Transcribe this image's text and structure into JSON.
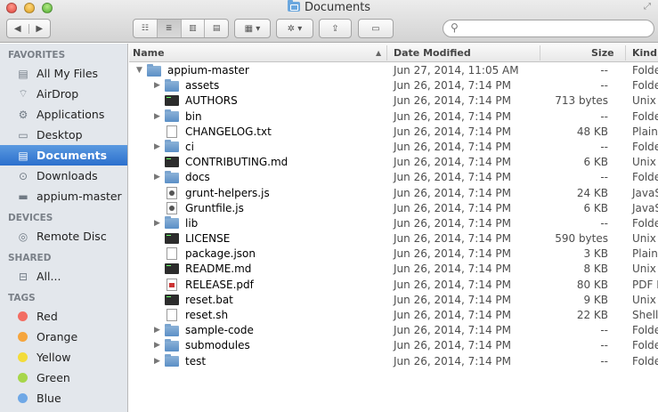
{
  "window": {
    "title": "Documents",
    "nav_back": "◀",
    "nav_forward": "▶",
    "view_icons": [
      "☷",
      "≣",
      "▥",
      "▤"
    ],
    "arrange": "▦ ▾",
    "action": "✲ ▾",
    "share": "⇪",
    "tag": "▭",
    "search": {
      "value": "",
      "placeholder": ""
    }
  },
  "sidebar": {
    "favorites_label": "FAVORITES",
    "favorites": [
      {
        "label": "All My Files",
        "icon": "all-files-icon",
        "glyph": "▤"
      },
      {
        "label": "AirDrop",
        "icon": "airdrop-icon",
        "glyph": "⌔"
      },
      {
        "label": "Applications",
        "icon": "applications-icon",
        "glyph": "⚙"
      },
      {
        "label": "Desktop",
        "icon": "desktop-icon",
        "glyph": "▭"
      },
      {
        "label": "Documents",
        "icon": "documents-icon",
        "glyph": "▤",
        "selected": true
      },
      {
        "label": "Downloads",
        "icon": "downloads-icon",
        "glyph": "⊙"
      },
      {
        "label": "appium-master",
        "icon": "folder-icon",
        "glyph": "▬"
      }
    ],
    "devices_label": "DEVICES",
    "devices": [
      {
        "label": "Remote Disc",
        "icon": "disc-icon",
        "glyph": "◎"
      }
    ],
    "shared_label": "SHARED",
    "shared": [
      {
        "label": "All...",
        "icon": "network-icon",
        "glyph": "⊟"
      }
    ],
    "tags_label": "TAGS",
    "tags": [
      {
        "label": "Red",
        "color": "#f26d63"
      },
      {
        "label": "Orange",
        "color": "#f5a53d"
      },
      {
        "label": "Yellow",
        "color": "#f3dc3a"
      },
      {
        "label": "Green",
        "color": "#a7d64a"
      },
      {
        "label": "Blue",
        "color": "#6fa8e6"
      }
    ]
  },
  "list": {
    "columns": {
      "name": "Name",
      "sort_arrow": "▲",
      "date": "Date Modified",
      "size": "Size",
      "kind": "Kind"
    },
    "rows": [
      {
        "name": "appium-master",
        "date": "Jun 27, 2014, 11:05 AM",
        "size": "--",
        "kind": "Folder",
        "icon": "folder",
        "level": 0,
        "disclosure": "▼"
      },
      {
        "name": "assets",
        "date": "Jun 26, 2014, 7:14 PM",
        "size": "--",
        "kind": "Folder",
        "icon": "folder",
        "level": 1,
        "disclosure": "▶"
      },
      {
        "name": "AUTHORS",
        "date": "Jun 26, 2014, 7:14 PM",
        "size": "713 bytes",
        "kind": "Unix",
        "icon": "exec",
        "level": 1,
        "disclosure": ""
      },
      {
        "name": "bin",
        "date": "Jun 26, 2014, 7:14 PM",
        "size": "--",
        "kind": "Folder",
        "icon": "folder",
        "level": 1,
        "disclosure": "▶"
      },
      {
        "name": "CHANGELOG.txt",
        "date": "Jun 26, 2014, 7:14 PM",
        "size": "48 KB",
        "kind": "Plain",
        "icon": "doc",
        "level": 1,
        "disclosure": ""
      },
      {
        "name": "ci",
        "date": "Jun 26, 2014, 7:14 PM",
        "size": "--",
        "kind": "Folder",
        "icon": "folder",
        "level": 1,
        "disclosure": "▶"
      },
      {
        "name": "CONTRIBUTING.md",
        "date": "Jun 26, 2014, 7:14 PM",
        "size": "6 KB",
        "kind": "Unix",
        "icon": "exec",
        "level": 1,
        "disclosure": ""
      },
      {
        "name": "docs",
        "date": "Jun 26, 2014, 7:14 PM",
        "size": "--",
        "kind": "Folder",
        "icon": "folder",
        "level": 1,
        "disclosure": "▶"
      },
      {
        "name": "grunt-helpers.js",
        "date": "Jun 26, 2014, 7:14 PM",
        "size": "24 KB",
        "kind": "JavaS",
        "icon": "js",
        "level": 1,
        "disclosure": ""
      },
      {
        "name": "Gruntfile.js",
        "date": "Jun 26, 2014, 7:14 PM",
        "size": "6 KB",
        "kind": "JavaS",
        "icon": "js",
        "level": 1,
        "disclosure": ""
      },
      {
        "name": "lib",
        "date": "Jun 26, 2014, 7:14 PM",
        "size": "--",
        "kind": "Folder",
        "icon": "folder",
        "level": 1,
        "disclosure": "▶"
      },
      {
        "name": "LICENSE",
        "date": "Jun 26, 2014, 7:14 PM",
        "size": "590 bytes",
        "kind": "Unix",
        "icon": "exec",
        "level": 1,
        "disclosure": ""
      },
      {
        "name": "package.json",
        "date": "Jun 26, 2014, 7:14 PM",
        "size": "3 KB",
        "kind": "Plain",
        "icon": "doc",
        "level": 1,
        "disclosure": ""
      },
      {
        "name": "README.md",
        "date": "Jun 26, 2014, 7:14 PM",
        "size": "8 KB",
        "kind": "Unix",
        "icon": "exec",
        "level": 1,
        "disclosure": ""
      },
      {
        "name": "RELEASE.pdf",
        "date": "Jun 26, 2014, 7:14 PM",
        "size": "80 KB",
        "kind": "PDF D",
        "icon": "pdf",
        "level": 1,
        "disclosure": ""
      },
      {
        "name": "reset.bat",
        "date": "Jun 26, 2014, 7:14 PM",
        "size": "9 KB",
        "kind": "Unix",
        "icon": "exec",
        "level": 1,
        "disclosure": ""
      },
      {
        "name": "reset.sh",
        "date": "Jun 26, 2014, 7:14 PM",
        "size": "22 KB",
        "kind": "Shell",
        "icon": "doc",
        "level": 1,
        "disclosure": ""
      },
      {
        "name": "sample-code",
        "date": "Jun 26, 2014, 7:14 PM",
        "size": "--",
        "kind": "Folder",
        "icon": "folder",
        "level": 1,
        "disclosure": "▶"
      },
      {
        "name": "submodules",
        "date": "Jun 26, 2014, 7:14 PM",
        "size": "--",
        "kind": "Folder",
        "icon": "folder",
        "level": 1,
        "disclosure": "▶"
      },
      {
        "name": "test",
        "date": "Jun 26, 2014, 7:14 PM",
        "size": "--",
        "kind": "Folder",
        "icon": "folder",
        "level": 1,
        "disclosure": "▶"
      }
    ]
  }
}
